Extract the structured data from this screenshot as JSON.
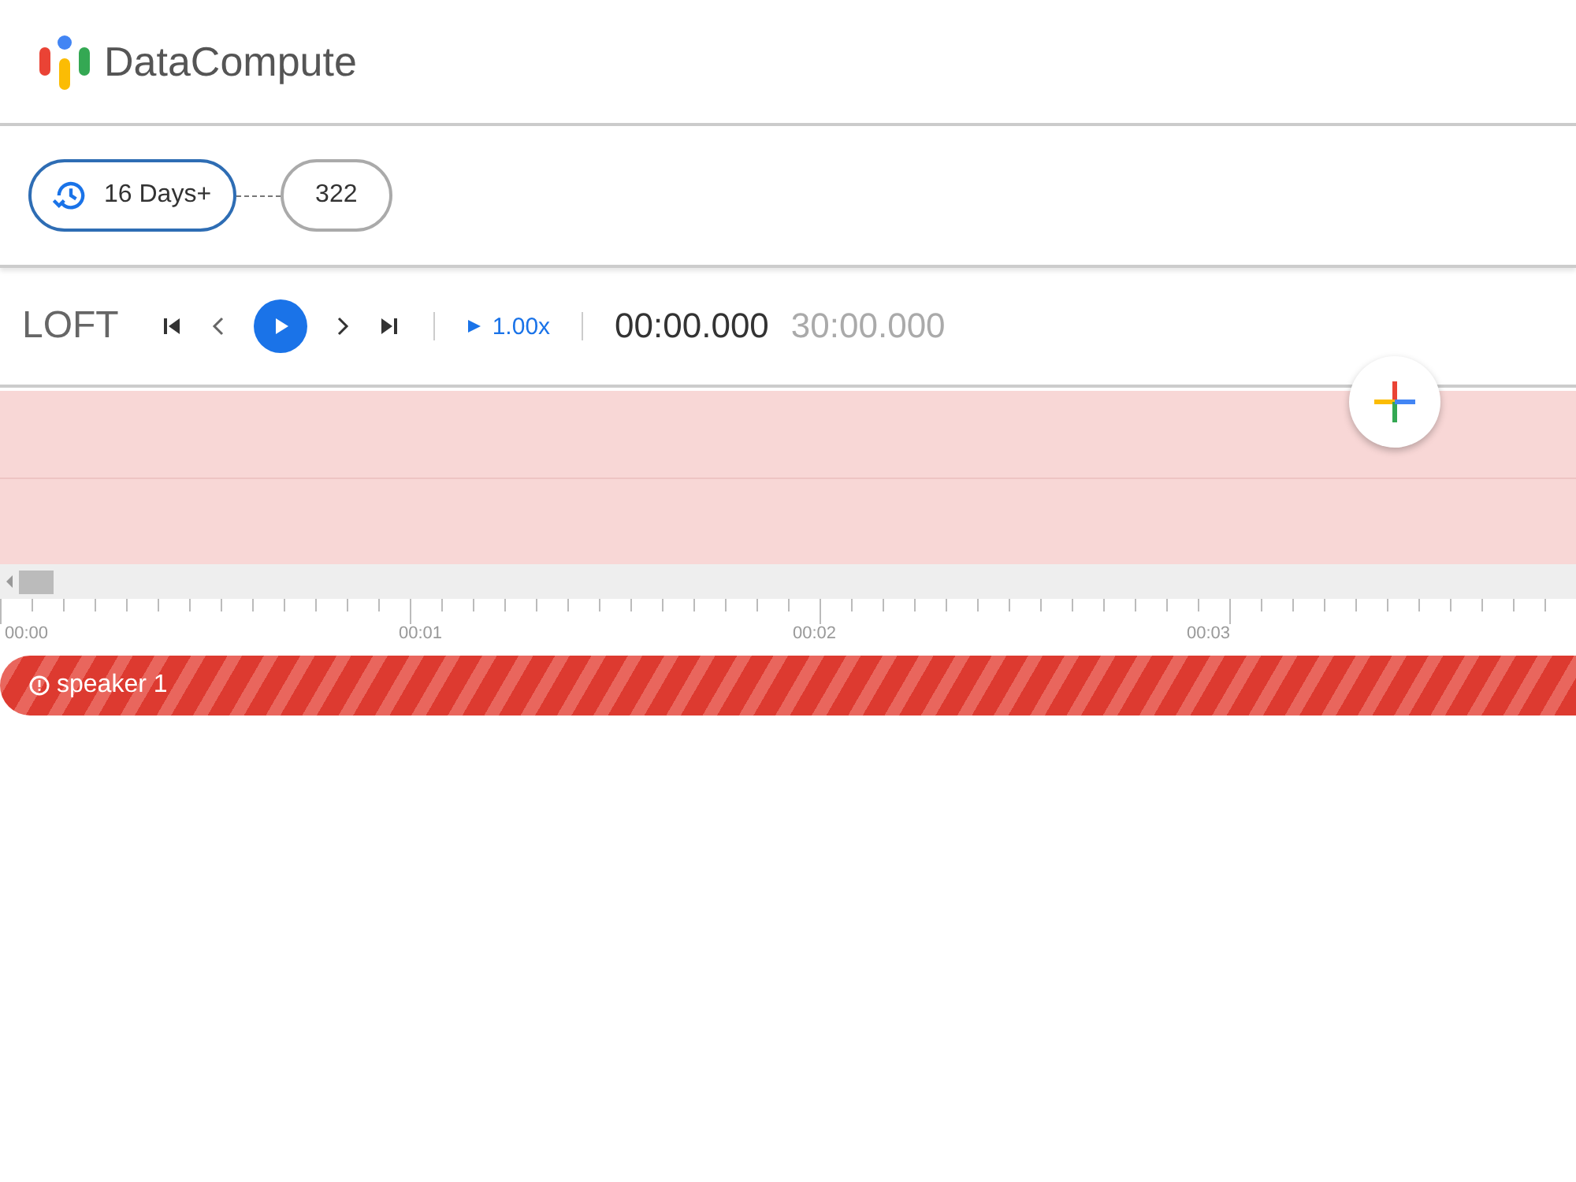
{
  "brand": {
    "name": "DataCompute"
  },
  "chips": [
    {
      "label": "16 Days+",
      "selected": true,
      "kind": "history"
    },
    {
      "label": "322",
      "selected": false,
      "kind": "plain"
    }
  ],
  "player": {
    "title": "LOFT",
    "speed": "1.00x",
    "current_time": "00:00.000",
    "total_time": "30:00.000"
  },
  "ruler": {
    "labels": [
      "00:00",
      "00:01",
      "00:02",
      "00:03"
    ]
  },
  "tracks": [
    {
      "label": "speaker 1"
    }
  ]
}
